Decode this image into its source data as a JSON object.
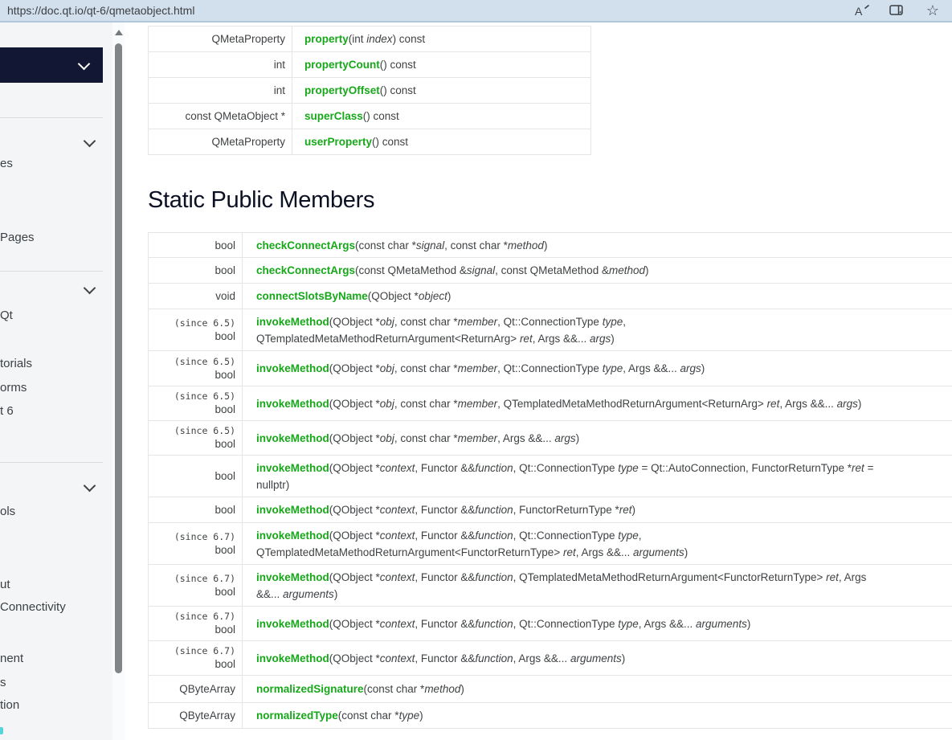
{
  "browser": {
    "url": "https://doc.qt.io/qt-6/qmetaobject.html",
    "icons": {
      "read_aloud": "read-aloud-icon",
      "immersive_reader": "immersive-reader-icon",
      "favorites_star_glyph": "☆"
    },
    "bar_bg_color": "#d2e0ee"
  },
  "sidebar": {
    "dropdown": {
      "chevron_icon": "chevron-down-icon"
    },
    "fragments": [
      "es",
      "Pages",
      "Qt",
      "torials",
      "orms",
      "t 6",
      "ols",
      "ut",
      "Connectivity",
      "nent",
      "s",
      "tion"
    ]
  },
  "main": {
    "heading": "Static Public Members",
    "public_members": [
      {
        "type": "QMetaProperty",
        "name": "property",
        "args_html": "(int <i>index</i>) const"
      },
      {
        "type": "int",
        "name": "propertyCount",
        "args_html": "() const"
      },
      {
        "type": "int",
        "name": "propertyOffset",
        "args_html": "() const"
      },
      {
        "type": "const QMetaObject *",
        "name": "superClass",
        "args_html": "() const"
      },
      {
        "type": "QMetaProperty",
        "name": "userProperty",
        "args_html": "() const"
      }
    ],
    "static_members": [
      {
        "type": "bool",
        "name": "checkConnectArgs",
        "args_html": "(const char *<i>signal</i>, const char *<i>method</i>)"
      },
      {
        "type": "bool",
        "name": "checkConnectArgs",
        "args_html": "(const QMetaMethod &amp;<i>signal</i>, const QMetaMethod &amp;<i>method</i>)"
      },
      {
        "type": "void",
        "name": "connectSlotsByName",
        "args_html": "(QObject *<i>object</i>)"
      },
      {
        "since": "(since 6.5)",
        "type": "bool",
        "name": "invokeMethod",
        "args_html": "(QObject *<i>obj</i>, const char *<i>member</i>, Qt::ConnectionType <i>type</i>,<br>QTemplatedMetaMethodReturnArgument&lt;ReturnArg&gt; <i>ret</i>, Args &amp;&amp;... <i>args</i>)"
      },
      {
        "since": "(since 6.5)",
        "type": "bool",
        "name": "invokeMethod",
        "args_html": "(QObject *<i>obj</i>, const char *<i>member</i>, Qt::ConnectionType <i>type</i>, Args &amp;&amp;... <i>args</i>)"
      },
      {
        "since": "(since 6.5)",
        "type": "bool",
        "name": "invokeMethod",
        "args_html": "(QObject *<i>obj</i>, const char *<i>member</i>, QTemplatedMetaMethodReturnArgument&lt;ReturnArg&gt; <i>ret</i>, Args &amp;&amp;... <i>args</i>)"
      },
      {
        "since": "(since 6.5)",
        "type": "bool",
        "name": "invokeMethod",
        "args_html": "(QObject *<i>obj</i>, const char *<i>member</i>, Args &amp;&amp;... <i>args</i>)"
      },
      {
        "type": "bool",
        "name": "invokeMethod",
        "args_html": "(QObject *<i>context</i>, Functor &amp;&amp;<i>function</i>, Qt::ConnectionType <i>type</i> = Qt::AutoConnection, FunctorReturnType *<i>ret</i> =<br>nullptr)"
      },
      {
        "type": "bool",
        "name": "invokeMethod",
        "args_html": "(QObject *<i>context</i>, Functor &amp;&amp;<i>function</i>, FunctorReturnType *<i>ret</i>)"
      },
      {
        "since": "(since 6.7)",
        "type": "bool",
        "name": "invokeMethod",
        "args_html": "(QObject *<i>context</i>, Functor &amp;&amp;<i>function</i>, Qt::ConnectionType <i>type</i>,<br>QTemplatedMetaMethodReturnArgument&lt;FunctorReturnType&gt; <i>ret</i>, Args &amp;&amp;... <i>arguments</i>)"
      },
      {
        "since": "(since 6.7)",
        "type": "bool",
        "name": "invokeMethod",
        "args_html": "(QObject *<i>context</i>, Functor &amp;&amp;<i>function</i>, QTemplatedMetaMethodReturnArgument&lt;FunctorReturnType&gt; <i>ret</i>, Args<br>&amp;&amp;... <i>arguments</i>)"
      },
      {
        "since": "(since 6.7)",
        "type": "bool",
        "name": "invokeMethod",
        "args_html": "(QObject *<i>context</i>, Functor &amp;&amp;<i>function</i>, Qt::ConnectionType <i>type</i>, Args &amp;&amp;... <i>arguments</i>)"
      },
      {
        "since": "(since 6.7)",
        "type": "bool",
        "name": "invokeMethod",
        "args_html": "(QObject *<i>context</i>, Functor &amp;&amp;<i>function</i>, Args &amp;&amp;... <i>arguments</i>)"
      },
      {
        "type": "QByteArray",
        "name": "normalizedSignature",
        "args_html": "(const char *<i>method</i>)"
      },
      {
        "type": "QByteArray",
        "name": "normalizedType",
        "args_html": "(const char *<i>type</i>)"
      }
    ]
  },
  "colors": {
    "link_green": "#17a81a",
    "heading_navy": "#0b1023",
    "body_text": "#3f4244",
    "navy_dropdown": "#121733",
    "sidebar_bg": "#f4f5f7",
    "table_border": "#e4e5e8",
    "browser_bar_bg": "#d2e0ee"
  }
}
